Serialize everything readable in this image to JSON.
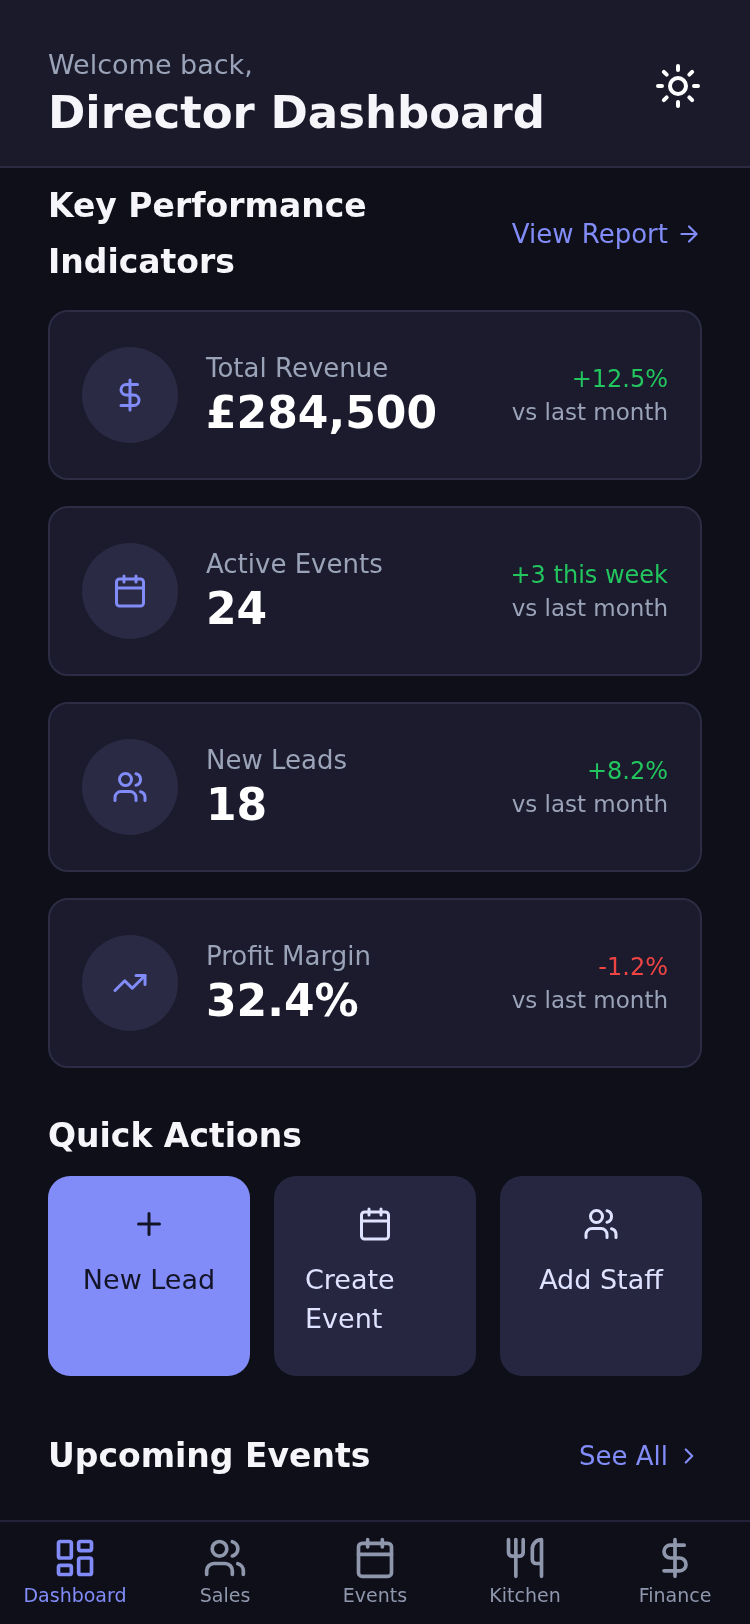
{
  "header": {
    "greeting": "Welcome back,",
    "title": "Director Dashboard"
  },
  "kpi": {
    "title": "Key Performance Indicators",
    "link": "View Report",
    "cards": [
      {
        "label": "Total Revenue",
        "value": "£284,500",
        "change": "+12.5%",
        "positive": true,
        "note": "vs last month"
      },
      {
        "label": "Active Events",
        "value": "24",
        "change": "+3 this week",
        "positive": true,
        "note": "vs last month"
      },
      {
        "label": "New Leads",
        "value": "18",
        "change": "+8.2%",
        "positive": true,
        "note": "vs last month"
      },
      {
        "label": "Profit Margin",
        "value": "32.4%",
        "change": "-1.2%",
        "positive": false,
        "note": "vs last month"
      }
    ]
  },
  "quick_actions": {
    "title": "Quick Actions",
    "items": [
      {
        "label": "New Lead",
        "primary": true
      },
      {
        "label": "Create Event",
        "primary": false
      },
      {
        "label": "Add Staff",
        "primary": false
      }
    ]
  },
  "upcoming": {
    "title": "Upcoming Events",
    "link": "See All"
  },
  "nav": [
    {
      "label": "Dashboard",
      "selected": true
    },
    {
      "label": "Sales",
      "selected": false
    },
    {
      "label": "Events",
      "selected": false
    },
    {
      "label": "Kitchen",
      "selected": false
    },
    {
      "label": "Finance",
      "selected": false
    }
  ]
}
